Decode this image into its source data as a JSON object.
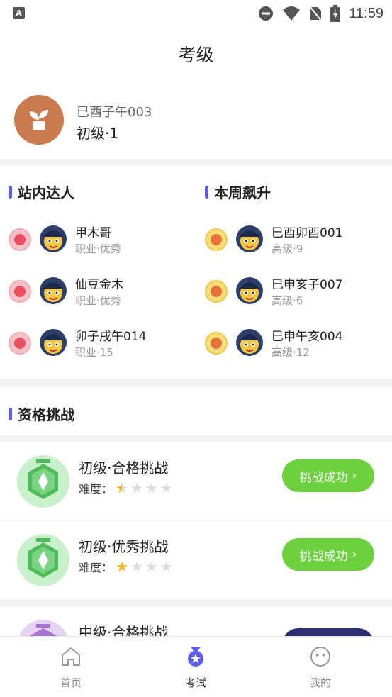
{
  "status_bar": {
    "left_icon": "A",
    "time": "11:59",
    "icons": [
      "do-not-disturb-icon",
      "wifi-icon",
      "no-sim-icon",
      "battery-charging-icon"
    ]
  },
  "header": {
    "title": "考级"
  },
  "profile": {
    "name": "巳酉子午003",
    "level": "初级·1"
  },
  "rankings": {
    "station_experts": {
      "title": "站内达人",
      "items": [
        {
          "name": "甲木哥",
          "sub": "职业·优秀"
        },
        {
          "name": "仙豆金木",
          "sub": "职业·优秀"
        },
        {
          "name": "卯子戌午014",
          "sub": "职业·15"
        }
      ]
    },
    "weekly_rising": {
      "title": "本周飙升",
      "items": [
        {
          "name": "巳酉卯酉001",
          "sub": "高级·9"
        },
        {
          "name": "巳申亥子007",
          "sub": "高级·6"
        },
        {
          "name": "巳申午亥004",
          "sub": "高级·12"
        }
      ]
    }
  },
  "challenges": {
    "title": "资格挑战",
    "difficulty_label": "难度：",
    "items": [
      {
        "title": "初级·合格挑战",
        "stars": 0.5,
        "button": "挑战成功"
      },
      {
        "title": "初级·优秀挑战",
        "stars": 1,
        "button": "挑战成功"
      },
      {
        "title": "中级·合格挑战",
        "stars": 0,
        "button": ""
      }
    ]
  },
  "colors": {
    "accent": "#5a5ee8",
    "success": "#6dd13f",
    "star": "#f7b51c"
  },
  "tabbar": {
    "tabs": [
      {
        "label": "首页",
        "icon": "home-icon",
        "active": false
      },
      {
        "label": "考试",
        "icon": "medal-icon",
        "active": true
      },
      {
        "label": "我的",
        "icon": "profile-face-icon",
        "active": false
      }
    ]
  }
}
